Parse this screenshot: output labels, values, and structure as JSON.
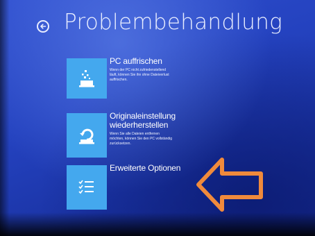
{
  "header": {
    "title": "Problembehandlung",
    "back_icon": "back-arrow-icon"
  },
  "options": [
    {
      "title": "PC auffrischen",
      "description": "Wenn der PC nicht zufriedenstellend läuft, können Sie ihn ohne Dateiverlust auffrischen.",
      "icon": "refresh-pc-icon"
    },
    {
      "title": "Originaleinstellung wiederherstellen",
      "description": "Wenn Sie alle Dateien entfernen möchten, können Sie den PC vollständig zurücksetzen.",
      "icon": "reset-pc-icon"
    },
    {
      "title": "Erweiterte Optionen",
      "description": "",
      "icon": "checklist-icon"
    }
  ],
  "colors": {
    "background": "#2442bf",
    "tile": "#44a8ee",
    "annotation_arrow": "#f08a3c"
  },
  "annotation": {
    "icon": "orange-arrow-left-icon"
  }
}
